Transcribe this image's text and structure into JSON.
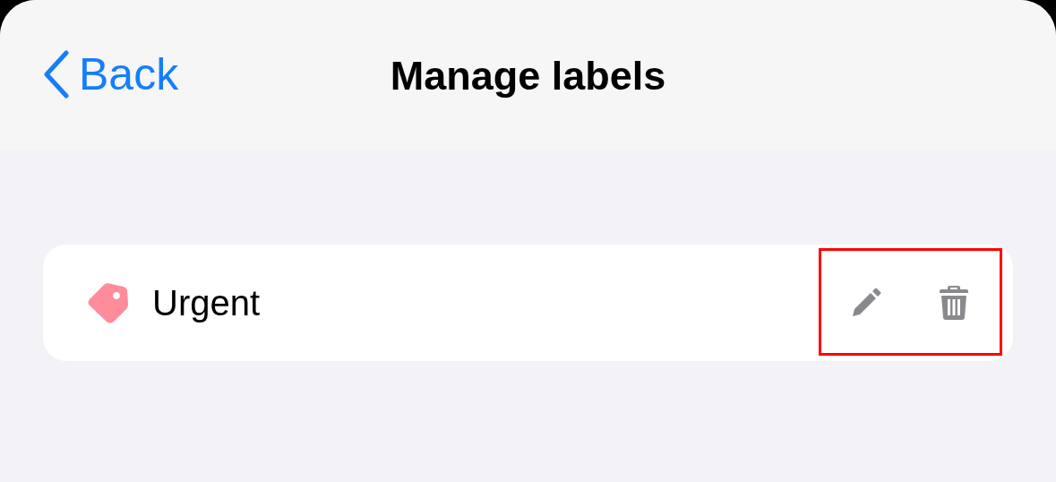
{
  "nav": {
    "back": "Back",
    "title": "Manage labels"
  },
  "labels": [
    {
      "name": "Urgent",
      "color": "#ff8c9b",
      "highlighted": true
    }
  ]
}
